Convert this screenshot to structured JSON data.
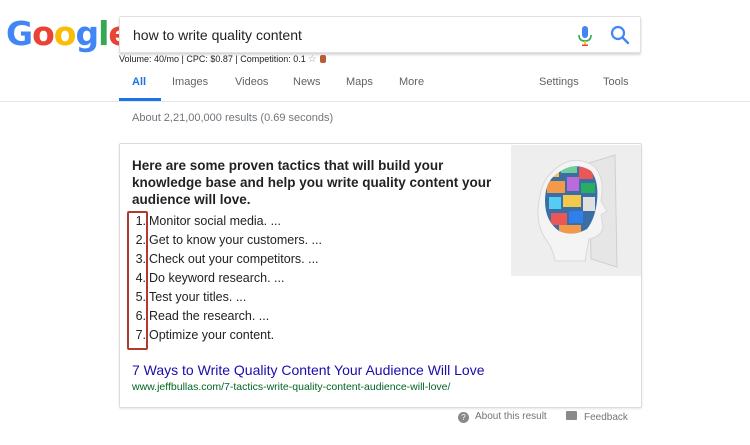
{
  "logo": {
    "letters": [
      "G",
      "o",
      "o",
      "g",
      "l",
      "e"
    ],
    "colors": [
      "#4285F4",
      "#EA4335",
      "#FBBC05",
      "#4285F4",
      "#34A853",
      "#EA4335"
    ]
  },
  "search": {
    "query": "how to write quality content"
  },
  "keyword_stats": {
    "text": "Volume: 40/mo | CPC: $0.87 | Competition: 0.1"
  },
  "nav": {
    "tabs": [
      "All",
      "Images",
      "Videos",
      "News",
      "Maps",
      "More"
    ],
    "active_tab": "All",
    "settings": "Settings",
    "tools": "Tools"
  },
  "results": {
    "stats": "About 2,21,00,000 results (0.69 seconds)"
  },
  "snippet": {
    "heading": "Here are some proven tactics that will build your knowledge base and help you write quality content your audience will love.",
    "steps": [
      {
        "num": "1.",
        "text": "Monitor social media. ..."
      },
      {
        "num": "2.",
        "text": "Get to know your customers. ..."
      },
      {
        "num": "3.",
        "text": "Check out your competitors. ..."
      },
      {
        "num": "4.",
        "text": "Do keyword research. ..."
      },
      {
        "num": "5.",
        "text": "Test your titles. ..."
      },
      {
        "num": "6.",
        "text": "Read the research. ..."
      },
      {
        "num": "7.",
        "text": "Optimize your content."
      }
    ],
    "title": "7 Ways to Write Quality Content Your Audience Will Love",
    "url": "www.jeffbullas.com/7-tactics-write-quality-content-audience-will-love/"
  },
  "footer": {
    "about": "About this result",
    "feedback": "Feedback"
  },
  "colors": {
    "link": "#1a0dab",
    "url": "#006621",
    "accent": "#1a73e8",
    "highlight_box": "#b03a2e"
  }
}
